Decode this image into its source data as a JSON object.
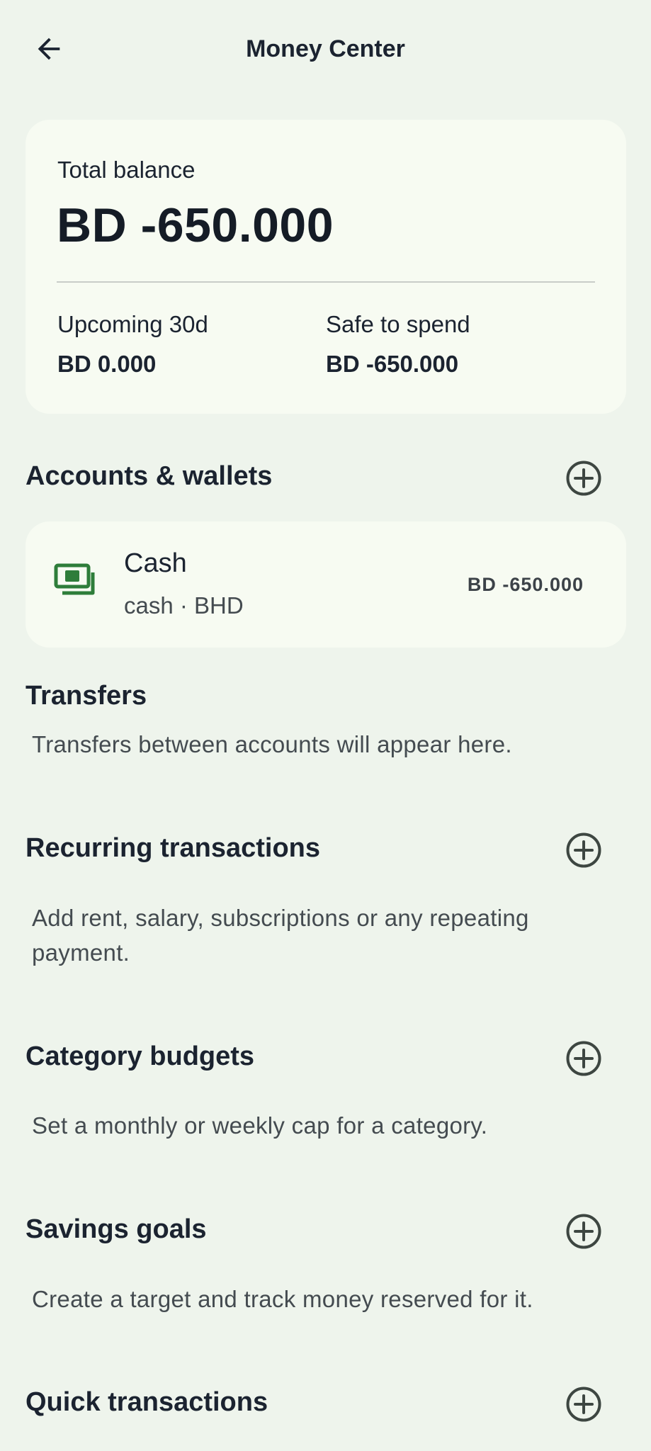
{
  "header": {
    "title": "Money Center",
    "back_icon": "arrow-left-icon"
  },
  "summary": {
    "total_label": "Total balance",
    "total_value": "BD -650.000",
    "upcoming_label": "Upcoming 30d",
    "upcoming_value": "BD 0.000",
    "safe_label": "Safe to spend",
    "safe_value": "BD -650.000"
  },
  "accounts": {
    "title": "Accounts & wallets",
    "add_icon": "plus-circle-icon",
    "items": [
      {
        "name": "Cash",
        "meta": "cash · BHD",
        "amount": "BD -650.000",
        "icon": "cash-icon"
      }
    ]
  },
  "transfers": {
    "title": "Transfers",
    "description": "Transfers between accounts will appear here."
  },
  "recurring": {
    "title": "Recurring transactions",
    "description": "Add rent, salary, subscriptions or any repeating payment."
  },
  "budgets": {
    "title": "Category budgets",
    "description": "Set a monthly or weekly cap for a category."
  },
  "savings": {
    "title": "Savings goals",
    "description": "Create a target and track money reserved for it."
  },
  "quick": {
    "title": "Quick transactions"
  },
  "colors": {
    "background": "#EEF4EC",
    "card": "#F7FBF2",
    "text": "#1B2330",
    "muted_text": "#444B50",
    "cash_icon": "#2E7D3A",
    "add_icon": "#3D4641"
  }
}
